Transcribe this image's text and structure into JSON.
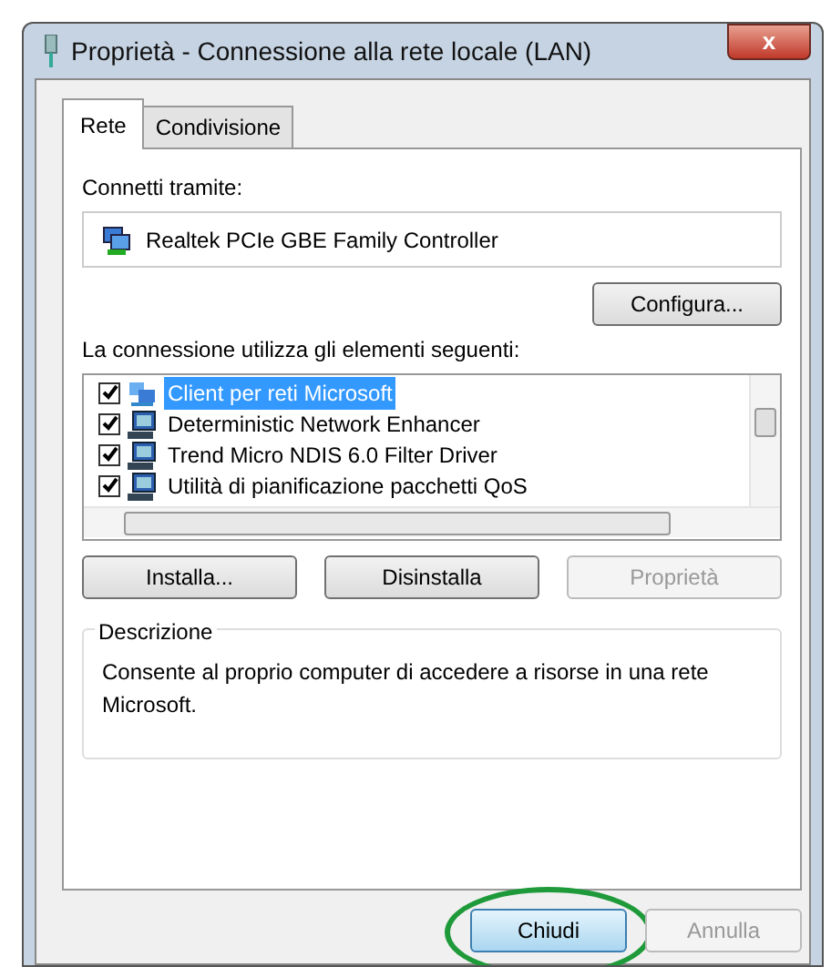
{
  "window": {
    "title": "Proprietà - Connessione alla rete locale (LAN)",
    "close": "x"
  },
  "tabs": [
    {
      "label": "Rete",
      "selected": true
    },
    {
      "label": "Condivisione",
      "selected": false
    }
  ],
  "connect_label": "Connetti tramite:",
  "adapter": "Realtek PCIe GBE Family Controller",
  "configure_button": "Configura...",
  "items_label": "La connessione utilizza gli elementi seguenti:",
  "items": [
    {
      "label": "Client per reti Microsoft",
      "checked": true,
      "selected": true,
      "kind": "client"
    },
    {
      "label": "Deterministic Network Enhancer",
      "checked": true,
      "selected": false,
      "kind": "service"
    },
    {
      "label": "Trend Micro NDIS 6.0 Filter Driver",
      "checked": true,
      "selected": false,
      "kind": "service"
    },
    {
      "label": "Utilità di pianificazione pacchetti QoS",
      "checked": true,
      "selected": false,
      "kind": "service"
    }
  ],
  "item_buttons": [
    {
      "label": "Installa...",
      "disabled": false
    },
    {
      "label": "Disinstalla",
      "disabled": false
    },
    {
      "label": "Proprietà",
      "disabled": true
    }
  ],
  "description": {
    "title": "Descrizione",
    "text": "Consente al proprio computer di accedere a risorse in una rete Microsoft."
  },
  "footer_buttons": [
    {
      "label": "Chiudi",
      "disabled": false,
      "default": true,
      "highlighted": true
    },
    {
      "label": "Annulla",
      "disabled": true,
      "default": false,
      "highlighted": false
    }
  ]
}
